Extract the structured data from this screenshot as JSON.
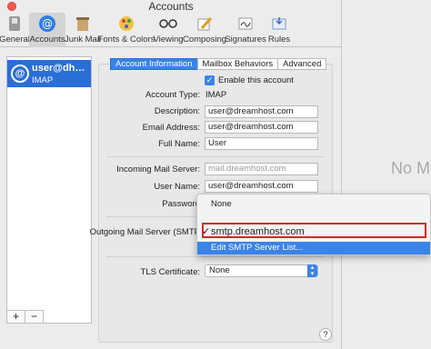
{
  "window": {
    "title": "Accounts"
  },
  "toolbar": {
    "items": [
      {
        "label": "General",
        "icon": "switch-icon"
      },
      {
        "label": "Accounts",
        "icon": "at-icon"
      },
      {
        "label": "Junk Mail",
        "icon": "trash-icon"
      },
      {
        "label": "Fonts & Colors",
        "icon": "palette-icon"
      },
      {
        "label": "Viewing",
        "icon": "glasses-icon"
      },
      {
        "label": "Composing",
        "icon": "pencil-icon"
      },
      {
        "label": "Signatures",
        "icon": "signature-icon"
      },
      {
        "label": "Rules",
        "icon": "rules-icon"
      }
    ]
  },
  "sidebar": {
    "account": {
      "name": "user@dh…",
      "type": "IMAP"
    },
    "add": "+",
    "remove": "−"
  },
  "tabs": [
    "Account Information",
    "Mailbox Behaviors",
    "Advanced"
  ],
  "form": {
    "enable_label": "Enable this account",
    "account_type_label": "Account Type:",
    "account_type_value": "IMAP",
    "description_label": "Description:",
    "description_value": "user@dreamhost.com",
    "email_label": "Email Address:",
    "email_value": "user@dreamhost.com",
    "fullname_label": "Full Name:",
    "fullname_value": "User",
    "incoming_label": "Incoming Mail Server:",
    "incoming_value": "mail.dreamhost.com",
    "username_label": "User Name:",
    "username_value": "user@dreamhost.com",
    "password_label": "Password",
    "outgoing_label": "Outgoing Mail Server (SMTP",
    "tls_label": "TLS Certificate:",
    "tls_value": "None"
  },
  "popup": {
    "none": "None",
    "smtp": "smtp.dreamhost.com",
    "edit": "Edit SMTP Server List..."
  },
  "right_pane": {
    "text": "No M"
  },
  "help": "?"
}
